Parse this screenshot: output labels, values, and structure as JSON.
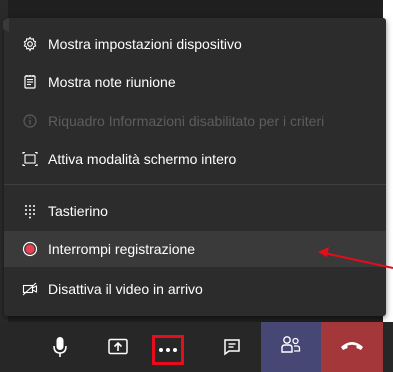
{
  "menu": {
    "items": [
      {
        "label": "Mostra impostazioni dispositivo",
        "icon": "gear-icon",
        "disabled": false
      },
      {
        "label": "Mostra note riunione",
        "icon": "notes-icon",
        "disabled": false
      },
      {
        "label": "Riquadro Informazioni disabilitato per i criteri",
        "icon": "info-icon",
        "disabled": true
      },
      {
        "label": "Attiva modalità schermo intero",
        "icon": "fullscreen-icon",
        "disabled": false
      },
      {
        "label": "Tastierino",
        "icon": "dialpad-icon",
        "disabled": false
      },
      {
        "label": "Interrompi registrazione",
        "icon": "record-icon",
        "disabled": false,
        "highlighted": true
      },
      {
        "label": "Disattiva il video in arrivo",
        "icon": "video-off-icon",
        "disabled": false
      }
    ]
  },
  "toolbar": {
    "buttons": [
      {
        "name": "microphone-button",
        "icon": "microphone-icon"
      },
      {
        "name": "share-screen-button",
        "icon": "share-icon"
      },
      {
        "name": "more-options-button",
        "icon": "more-icon"
      },
      {
        "name": "chat-button",
        "icon": "chat-icon"
      },
      {
        "name": "participants-button",
        "icon": "people-icon"
      },
      {
        "name": "hang-up-button",
        "icon": "phone-icon"
      }
    ]
  },
  "colors": {
    "menu_bg": "#2d2c2c",
    "highlight_bg": "#3b3a3a",
    "record_red": "#e8404f",
    "annotation_red": "#e80b1c",
    "people_bg": "#464775",
    "hangup_bg": "#a4373a",
    "disabled_text": "#5d5d5d"
  }
}
